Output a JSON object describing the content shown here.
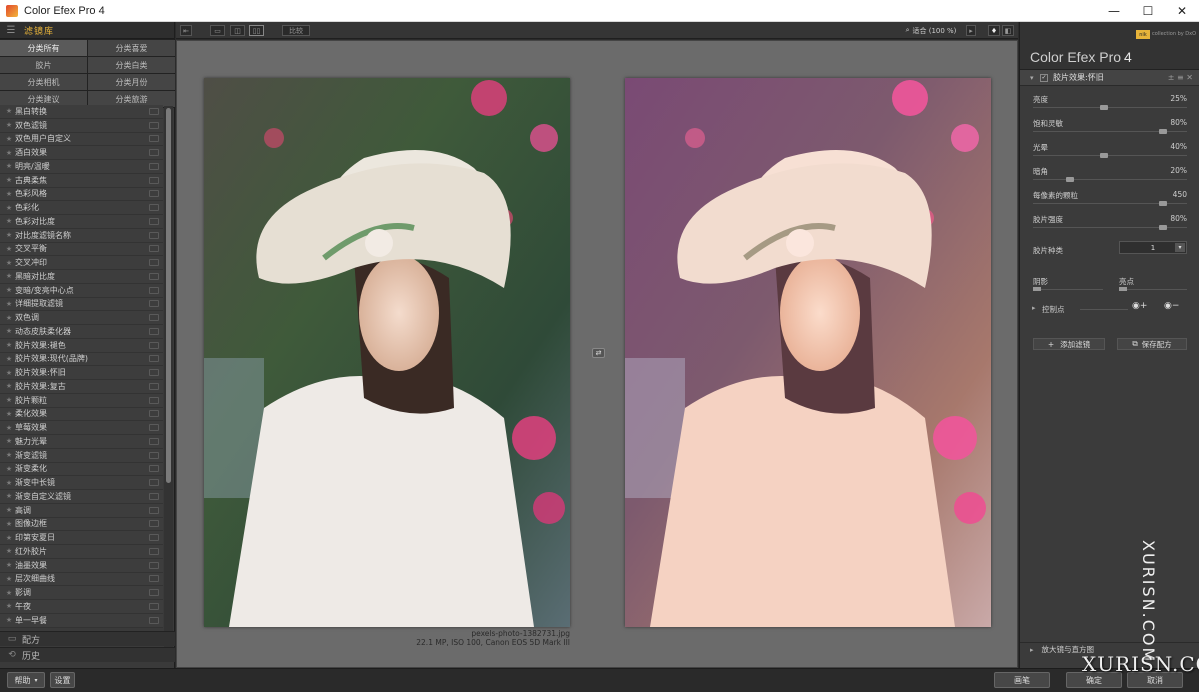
{
  "window": {
    "title": "Color Efex Pro 4",
    "minimize": "—",
    "maximize": "☐",
    "close": "✕"
  },
  "library": {
    "header": "滤镜库",
    "categories": [
      "分类所有",
      "分类喜爱",
      "胶片",
      "分类白类",
      "分类相机",
      "分类月份",
      "分类建议",
      "分类旅游"
    ],
    "filters": [
      "黑白转换",
      "双色滤镜",
      "双色用户自定义",
      "酒白效果",
      "明亮/温暖",
      "古典柔焦",
      "色彩风格",
      "色彩化",
      "色彩对比度",
      "对比度滤镜名称",
      "交叉平衡",
      "交叉冲印",
      "黑暗对比度",
      "变暗/变亮中心点",
      "详细提取滤镜",
      "双色调",
      "动态皮肤柔化器",
      "胶片效果:褪色",
      "胶片效果:现代(品牌)",
      "胶片效果:怀旧",
      "胶片效果:复古",
      "胶片颗粒",
      "柔化效果",
      "草莓效果",
      "魅力光晕",
      "渐变滤镜",
      "渐变柔化",
      "渐变中长镜",
      "渐变自定义滤镜",
      "高调",
      "图像边框",
      "印第安夏日",
      "红外胶片",
      "油墨效果",
      "层次细曲线",
      "影调",
      "午夜",
      "单一早餐"
    ],
    "recipes": "配方",
    "history": "历史"
  },
  "toolbar": {
    "compare_label": "比较",
    "zoom_label": "适合 (100 %)"
  },
  "images": {
    "filename": "pexels-photo-1382731.jpg",
    "meta": "22.1 MP, ISO 100, Canon EOS 5D Mark III"
  },
  "panel": {
    "brand": "Color Efex Pro",
    "version": "4",
    "nik_badge": "nik",
    "collection": "collection by DxO",
    "filter_name": "胶片效果:怀旧",
    "filter_controls": "±  ≡  ✕",
    "sliders": [
      {
        "label": "亮度",
        "value": "25%"
      },
      {
        "label": "饱和灵敏",
        "value": "80%"
      },
      {
        "label": "光晕",
        "value": "40%"
      },
      {
        "label": "暗角",
        "value": "20%"
      },
      {
        "label": "每像素的颗粒",
        "value": "450"
      },
      {
        "label": "胶片强度",
        "value": "80%"
      }
    ],
    "film_type_label": "胶片种类",
    "film_type_value": "1",
    "shadows_label": "阴影",
    "highlights_label": "亮点",
    "control_points_label": "控制点",
    "add_filter": "添加滤镜",
    "save_recipe": "保存配方",
    "loupe": "放大镜与直方图"
  },
  "footer": {
    "help": "帮助",
    "settings": "设置",
    "brush": "画笔",
    "ok": "确定",
    "cancel": "取消"
  },
  "watermark": {
    "vertical": "XURISN.COM",
    "bottom": "XURISN.COM"
  },
  "colors": {
    "accent": "#e8b43a",
    "panel": "#3b3b3b",
    "canvas": "#6b6b6b"
  }
}
